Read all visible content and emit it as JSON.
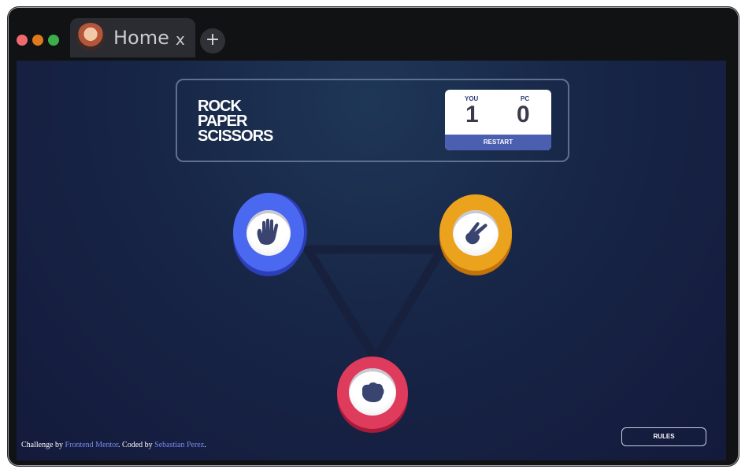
{
  "browser": {
    "tab_title": "Home",
    "tab_close": "x",
    "new_tab": "+"
  },
  "game": {
    "logo": [
      "ROCK",
      "PAPER",
      "SCISSORS"
    ],
    "score": {
      "you_label": "YOU",
      "you_value": "1",
      "pc_label": "PC",
      "pc_value": "0",
      "restart_label": "RESTART"
    },
    "choices": [
      {
        "name": "paper",
        "color": "#4b68f0"
      },
      {
        "name": "scissors",
        "color": "#eba21c"
      },
      {
        "name": "rock",
        "color": "#df3b5c"
      }
    ],
    "rules_label": "RULES"
  },
  "footer": {
    "challenge_prefix": "Challenge by ",
    "challenge_link": "Frontend Mentor",
    "coded_by": ". Coded by ",
    "author_link": "Sebastian Perez",
    "suffix": "."
  },
  "colors": {
    "background": "#172546",
    "accent": "#4b5fb0"
  }
}
